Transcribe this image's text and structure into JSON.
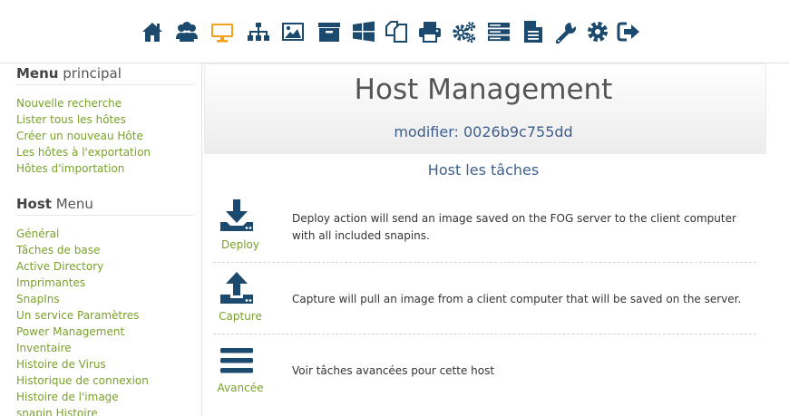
{
  "colors": {
    "icon": "#1c4a6e",
    "active_icon": "#f2a11c",
    "link": "#7aa12a",
    "heading": "#3d5f8f"
  },
  "nav_icons": [
    "home-icon",
    "users-icon",
    "monitor-icon",
    "sitemap-icon",
    "image-icon",
    "archive-icon",
    "windows-icon",
    "copy-icon",
    "print-icon",
    "cogs-icon",
    "server-icon",
    "file-icon",
    "wrench-icon",
    "gear-icon",
    "sign-out-icon"
  ],
  "active_nav": "monitor-icon",
  "sidebar": {
    "main_menu": {
      "title_bold": "Menu",
      "title_rest": " principal",
      "items": [
        "Nouvelle recherche",
        "Lister tous les hôtes",
        "Créer un nouveau Hôte",
        "Les hôtes à l'exportation",
        "Hôtes d'importation"
      ]
    },
    "host_menu": {
      "title_bold": "Host",
      "title_rest": " Menu",
      "items": [
        "Général",
        "Tâches de base",
        "Active Directory",
        "Imprimantes",
        "SnapIns",
        "Un service Paramètres",
        "Power Management",
        "Inventaire",
        "Histoire de Virus",
        "Historique de connexion",
        "Histoire de l'image",
        "snapin Histoire"
      ]
    }
  },
  "main": {
    "title": "Host Management",
    "subtitle": "modifier: 0026b9c755dd",
    "section_title": "Host les tâches",
    "tasks": [
      {
        "label": "Deploy",
        "icon": "download-icon",
        "description": "Deploy action will send an image saved on the FOG server to the client computer with all included snapins."
      },
      {
        "label": "Capture",
        "icon": "upload-icon",
        "description": "Capture will pull an image from a client computer that will be saved on the server."
      },
      {
        "label": "Avancée",
        "icon": "bars-icon",
        "description": "Voir tâches avancées pour cette host"
      }
    ]
  }
}
